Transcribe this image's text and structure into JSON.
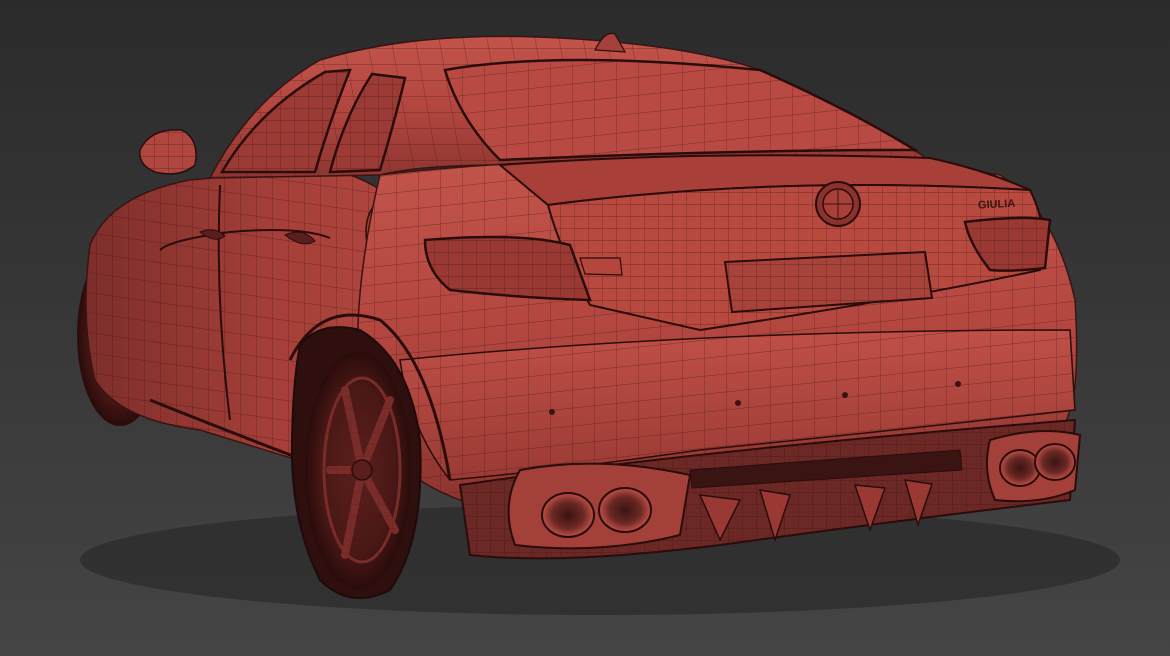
{
  "scene": {
    "background_color": "#3a3a3a",
    "model_color": "#b5463e",
    "wire_color": "#3a1412",
    "shadow_color": "#1e0a09",
    "rear_badge_text": "GIULIA"
  }
}
